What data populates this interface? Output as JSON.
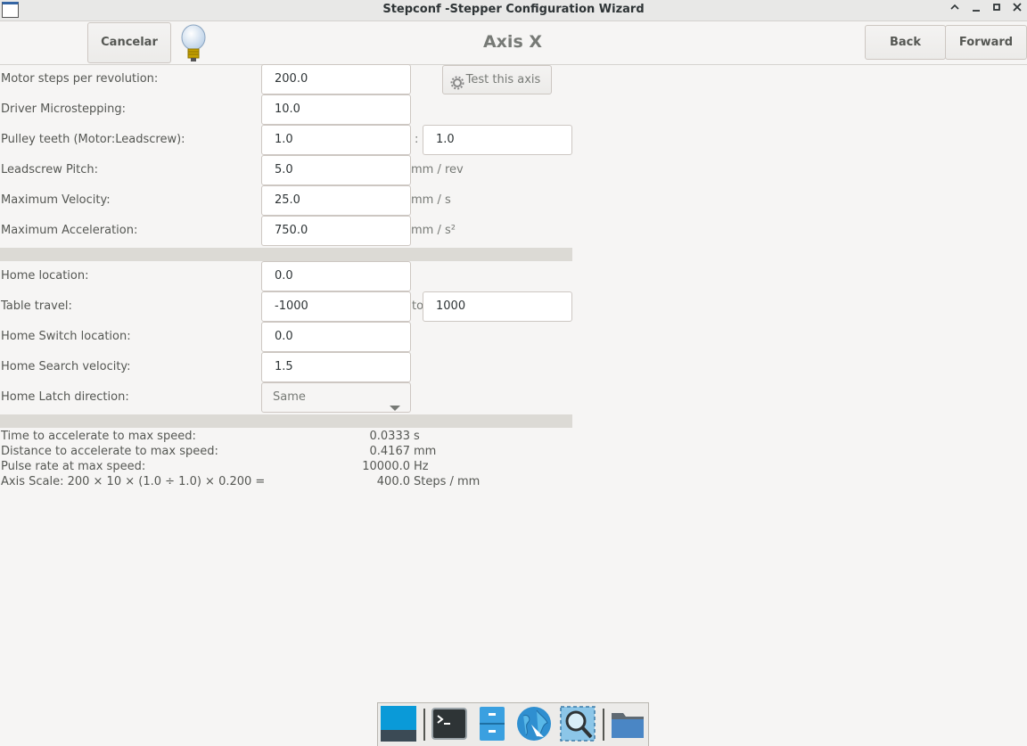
{
  "window": {
    "title": "Stepconf -Stepper Configuration Wizard"
  },
  "header": {
    "cancel_label": "Cancelar",
    "page_title": "Axis X",
    "back_label": "Back",
    "forward_label": "Forward"
  },
  "motor": {
    "steps_label": "Motor steps per revolution:",
    "steps_value": "200.0",
    "test_label": "Test this axis",
    "micro_label": "Driver Microstepping:",
    "micro_value": "10.0",
    "pulley_label": "Pulley teeth (Motor:Leadscrew):",
    "pulley_motor": "1.0",
    "pulley_sep": ":",
    "pulley_lead": "1.0",
    "pitch_label": "Leadscrew Pitch:",
    "pitch_value": "5.0",
    "pitch_unit": "mm / rev",
    "vel_label": "Maximum Velocity:",
    "vel_value": "25.0",
    "vel_unit": "mm / s",
    "acc_label": "Maximum Acceleration:",
    "acc_value": "750.0",
    "acc_unit": "mm / s²"
  },
  "homing": {
    "home_label": "Home location:",
    "home_value": "0.0",
    "travel_label": "Table travel:",
    "travel_min": "-1000",
    "travel_to": "to",
    "travel_max": "1000",
    "switch_label": "Home Switch location:",
    "switch_value": "0.0",
    "search_label": "Home Search velocity:",
    "search_value": "1.5",
    "latch_label": "Home Latch direction:",
    "latch_value": "Same"
  },
  "info": [
    {
      "label": "Time to accelerate to max speed:",
      "value": "0.0333",
      "unit": "s"
    },
    {
      "label": "Distance to accelerate to max speed:",
      "value": "0.4167",
      "unit": "mm"
    },
    {
      "label": "Pulse rate at max speed:",
      "value": "10000.0",
      "unit": "Hz"
    },
    {
      "label": "Axis Scale: 200 × 10 × (1.0 ÷ 1.0) × 0.200 =",
      "value": "400.0",
      "unit": "Steps / mm"
    }
  ],
  "dock": [
    "desktop-icon",
    "terminal-icon",
    "file-cabinet-icon",
    "web-browser-icon",
    "search-icon",
    "folder-icon"
  ]
}
